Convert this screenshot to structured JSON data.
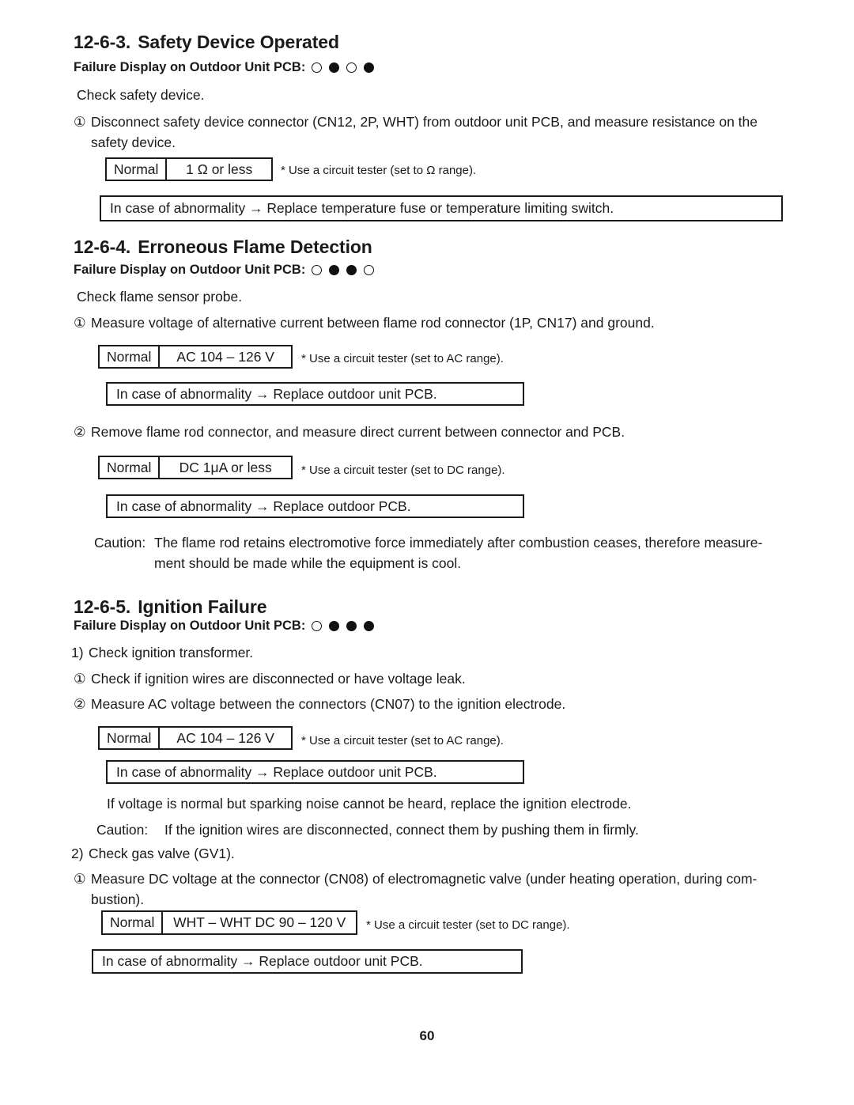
{
  "page": {
    "number": "60"
  },
  "sections": [
    {
      "id": "12-6-3",
      "number": "12-6-3.",
      "title": "Safety Device Operated",
      "failure_label": "Failure Display on Outdoor Unit PCB:",
      "leds": [
        "off",
        "on",
        "off",
        "on"
      ],
      "intro": "Check safety device.",
      "step1_marker": "①",
      "step1_line1": "Disconnect safety device connector (CN12, 2P, WHT) from outdoor unit PCB, and measure resistance on the",
      "step1_line2": "safety device.",
      "normal_label": "Normal",
      "normal_value": "1 Ω or less",
      "tester_note": "* Use a circuit tester (set to Ω range).",
      "abnormality": "In case of abnormality → Replace temperature fuse or temperature limiting switch."
    },
    {
      "id": "12-6-4",
      "number": "12-6-4.",
      "title": "Erroneous Flame Detection",
      "failure_label": "Failure Display on Outdoor Unit PCB:",
      "leds": [
        "off",
        "on",
        "on",
        "off"
      ],
      "intro": "Check flame sensor probe.",
      "step1_marker": "①",
      "step1_text": "Measure voltage of alternative current between flame rod connector (1P, CN17) and ground.",
      "normal_label_1": "Normal",
      "normal_value_1": "AC 104 – 126 V",
      "tester_note_1": "* Use a circuit tester (set to AC range).",
      "abnormality_1": "In case of abnormality → Replace outdoor unit PCB.",
      "step2_marker": "②",
      "step2_text": "Remove flame rod connector, and measure direct current between connector and PCB.",
      "normal_label_2": "Normal",
      "normal_value_2": "DC 1μA or less",
      "tester_note_2": "* Use a circuit tester (set to DC range).",
      "abnormality_2": "In case of abnormality → Replace outdoor PCB.",
      "caution_label": "Caution:",
      "caution_line1": "The flame rod retains electromotive force immediately after combustion ceases, therefore measure-",
      "caution_line2": "ment should be made while the equipment is cool."
    },
    {
      "id": "12-6-5",
      "number": "12-6-5.",
      "title": "Ignition Failure",
      "failure_label": "Failure Display on Outdoor Unit PCB:",
      "leds": [
        "off",
        "on",
        "on",
        "on"
      ],
      "item1_marker": "1)",
      "item1_text": "Check ignition transformer.",
      "step1_marker": "①",
      "step1_text": "Check if ignition wires are disconnected or have voltage leak.",
      "step2_marker": "②",
      "step2_text": "Measure AC voltage between the connectors (CN07) to the ignition electrode.",
      "normal_label_1": "Normal",
      "normal_value_1": "AC 104 – 126 V",
      "tester_note_1": "* Use a circuit tester (set to AC range).",
      "abnormality_1": "In case of abnormality → Replace outdoor unit PCB.",
      "note_text": "If voltage is normal but sparking noise cannot be heard, replace the ignition electrode.",
      "caution_label": "Caution:",
      "caution_text": "If the ignition wires are disconnected, connect them by pushing them in firmly.",
      "item2_marker": "2)",
      "item2_text": "Check gas valve (GV1).",
      "step3_marker": "①",
      "step3_line1": "Measure DC voltage at the connector (CN08) of electromagnetic valve (under heating operation, during com-",
      "step3_line2": "bustion).",
      "normal_label_2": "Normal",
      "normal_value_2": "WHT – WHT  DC 90 – 120 V",
      "tester_note_2": "* Use a circuit tester (set to DC range).",
      "abnormality_2": "In case of abnormality → Replace outdoor unit PCB."
    }
  ]
}
